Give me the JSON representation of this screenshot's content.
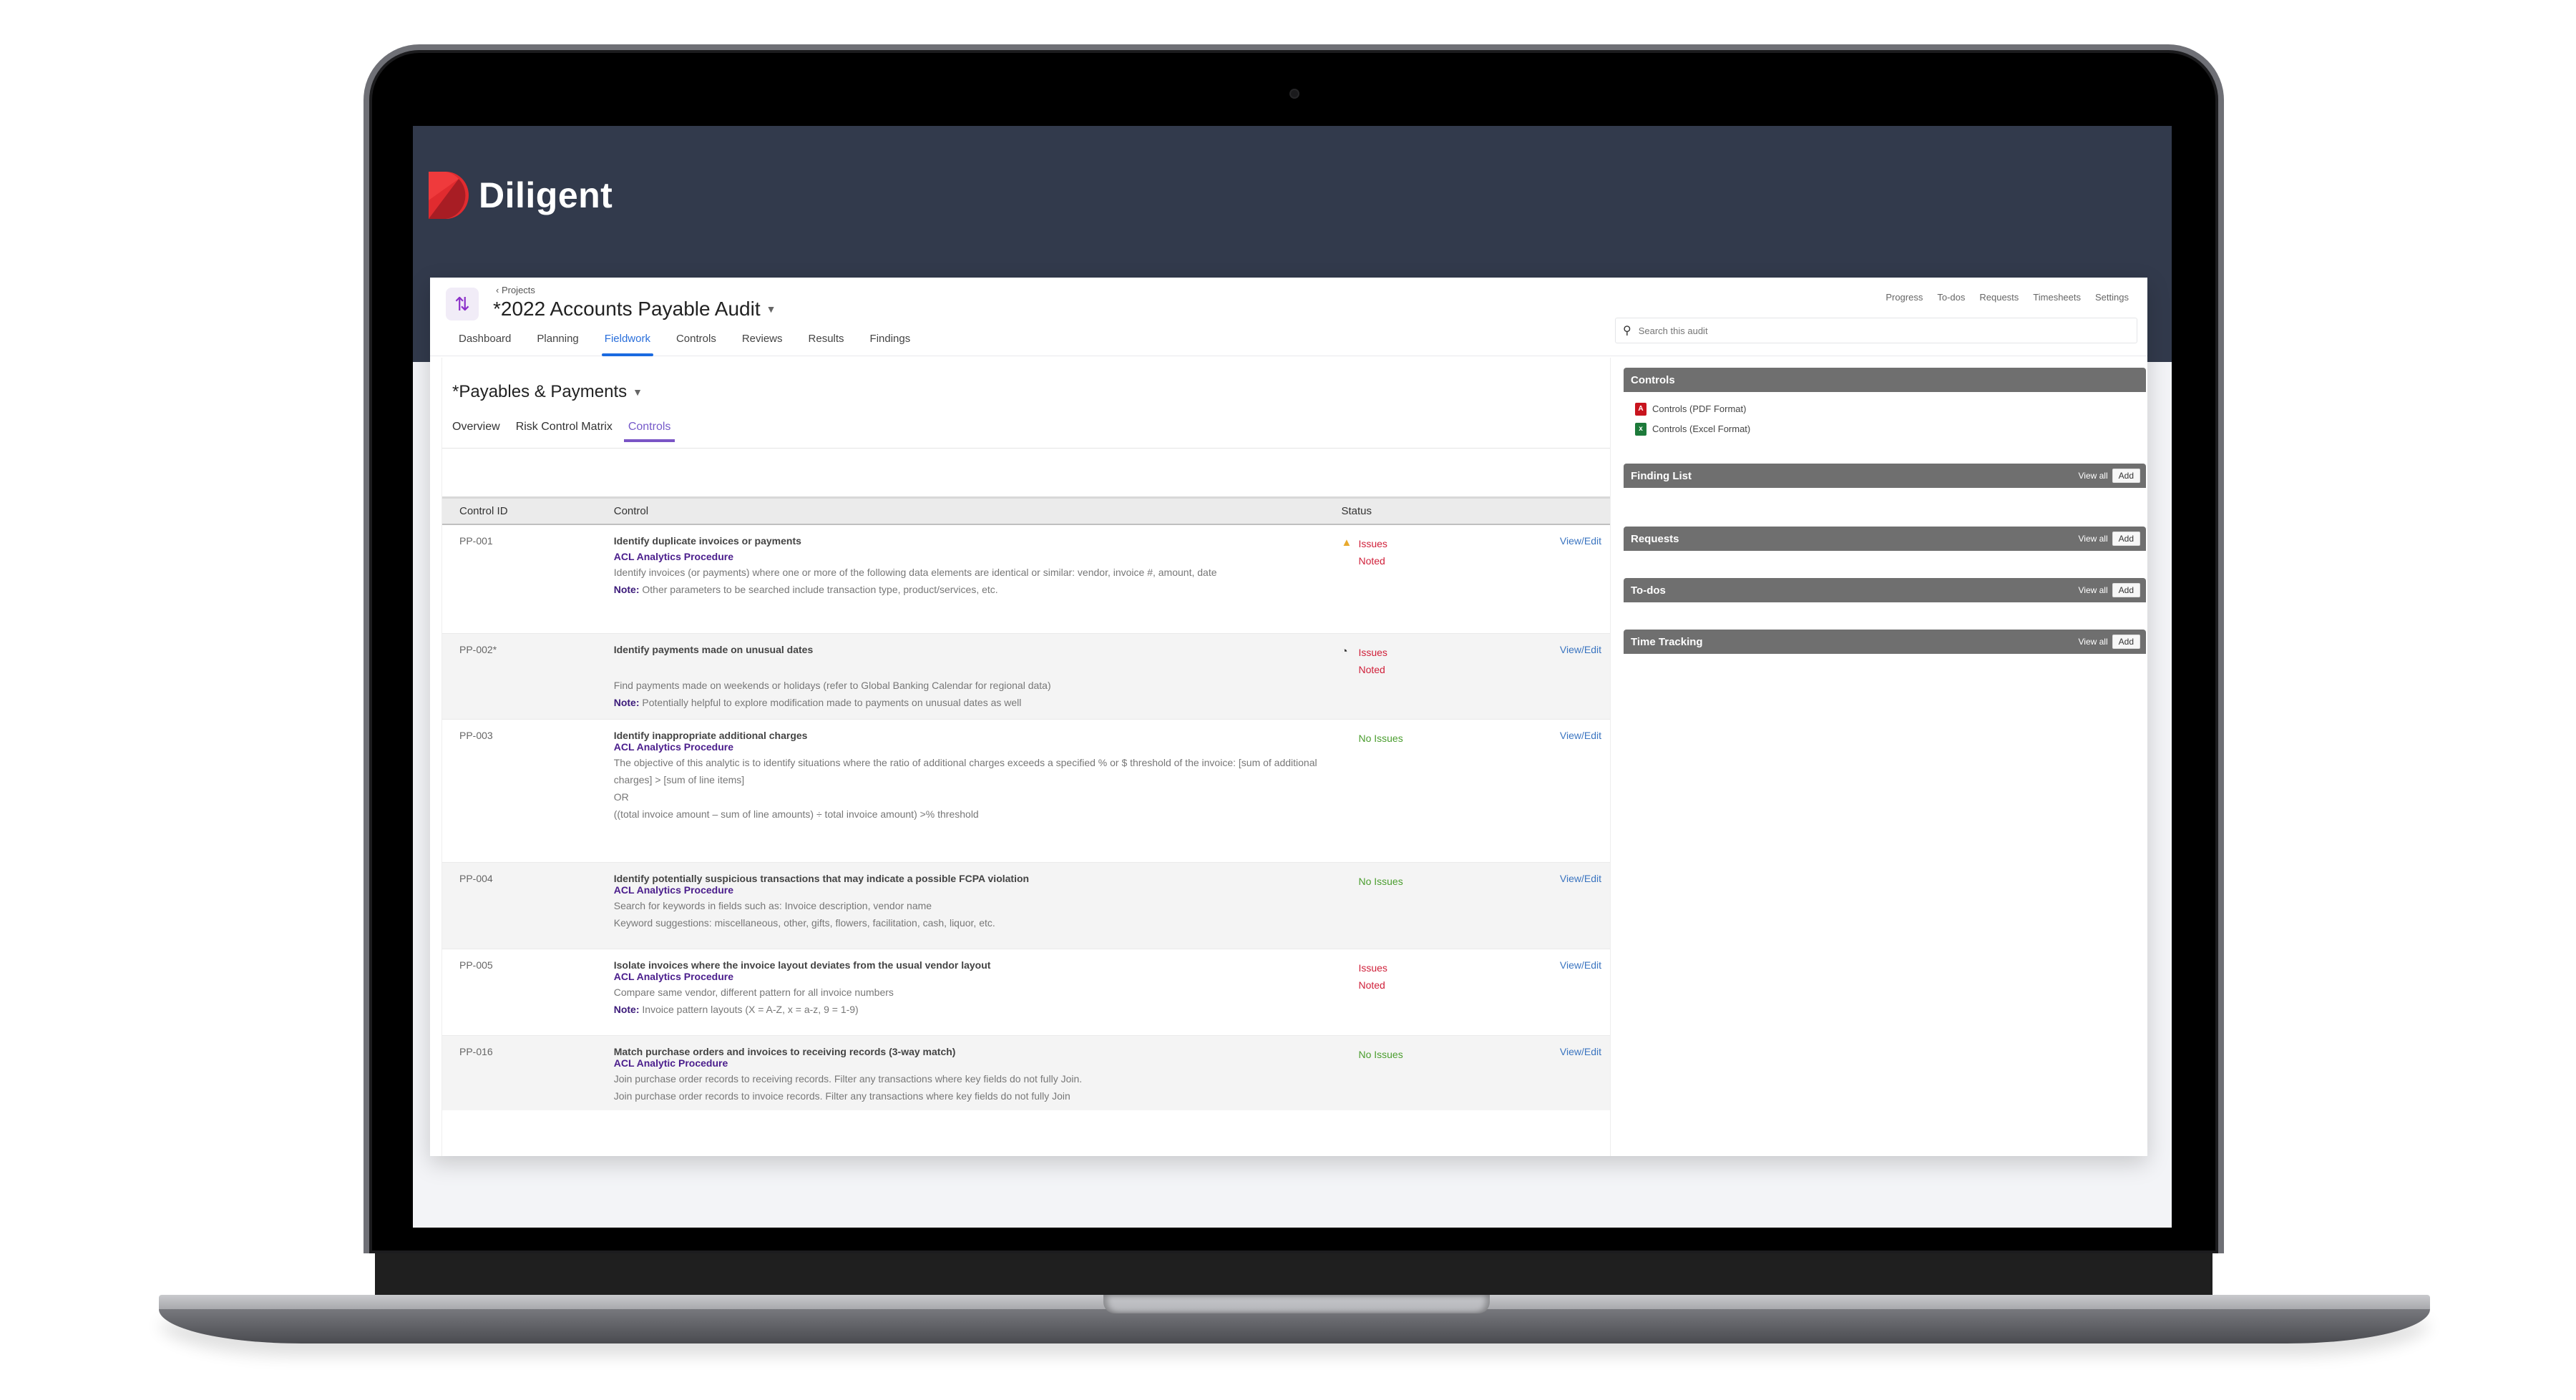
{
  "brand": {
    "name": "Diligent",
    "accent": "#e12b2f",
    "band_color": "#323a4c"
  },
  "header": {
    "breadcrumb": "Projects",
    "project_title": "*2022 Accounts Payable Audit",
    "tabs": [
      {
        "label": "Dashboard",
        "active": false
      },
      {
        "label": "Planning",
        "active": false
      },
      {
        "label": "Fieldwork",
        "active": true
      },
      {
        "label": "Controls",
        "active": false
      },
      {
        "label": "Reviews",
        "active": false
      },
      {
        "label": "Results",
        "active": false
      },
      {
        "label": "Findings",
        "active": false
      }
    ],
    "top_links": [
      "Progress",
      "To-dos",
      "Requests",
      "Timesheets",
      "Settings"
    ],
    "search": {
      "placeholder": "Search this audit",
      "value": ""
    }
  },
  "section": {
    "title": "*Payables & Payments",
    "subtabs": [
      {
        "label": "Overview",
        "active": false
      },
      {
        "label": "Risk Control Matrix",
        "active": false
      },
      {
        "label": "Controls",
        "active": true
      }
    ]
  },
  "table": {
    "columns": [
      "Control ID",
      "Control",
      "Status",
      ""
    ],
    "rows": [
      {
        "id": "PP-001",
        "title": "Identify duplicate invoices or payments",
        "procedure": "ACL Analytics Procedure",
        "description": [
          "Identify invoices (or payments) where one or more of the following data elements are identical or similar: vendor, invoice #, amount, date"
        ],
        "note": "Other parameters to be searched include transaction type, product/services, etc.",
        "status": "Issues Noted",
        "status_icon": "warning-icon",
        "action": "View/Edit"
      },
      {
        "id": "PP-002*",
        "title": "Identify payments made on unusual dates",
        "procedure": "",
        "description": [
          "Find payments made on weekends or holidays (refer to Global Banking Calendar for regional data)"
        ],
        "note": "Potentially helpful to explore modification made to payments on unusual dates as well",
        "status": "Issues Noted",
        "status_icon": "in-progress-icon",
        "action": "View/Edit"
      },
      {
        "id": "PP-003",
        "title": "Identify inappropriate additional charges",
        "procedure": "ACL Analytics Procedure",
        "description": [
          "The objective of this analytic is to identify situations where the ratio of additional charges exceeds a specified % or $ threshold of the invoice:    [sum of additional charges] > [sum of line items]",
          "OR",
          " ((total invoice amount – sum of line amounts) ÷ total invoice amount) >% threshold"
        ],
        "note": "",
        "status": "No Issues",
        "status_icon": "",
        "action": "View/Edit"
      },
      {
        "id": "PP-004",
        "title": "Identify potentially suspicious transactions that may indicate a possible FCPA violation",
        "procedure": "ACL Analytics Procedure",
        "description": [
          "Search for keywords in fields such as: Invoice description, vendor name",
          "Keyword suggestions: miscellaneous, other, gifts, flowers, facilitation, cash, liquor, etc."
        ],
        "note": "",
        "status": "No Issues",
        "status_icon": "",
        "action": "View/Edit"
      },
      {
        "id": "PP-005",
        "title": "Isolate invoices where the invoice layout deviates from the usual vendor layout",
        "procedure": "ACL Analytics Procedure",
        "description": [
          "Compare same vendor, different pattern for all invoice numbers"
        ],
        "note": "Invoice pattern layouts (X = A-Z, x = a-z, 9 = 1-9)",
        "status": "Issues Noted",
        "status_icon": "",
        "action": "View/Edit"
      },
      {
        "id": "PP-016",
        "title": "Match purchase orders and invoices to receiving records (3-way match)",
        "procedure": "ACL Analytic Procedure",
        "description": [
          "Join purchase order records to receiving records. Filter any transactions where key fields do not fully Join.",
          "Join purchase order records to invoice records. Filter any transactions where key fields do not fully Join"
        ],
        "note": "",
        "status": "No Issues",
        "status_icon": "",
        "action": "View/Edit"
      }
    ],
    "note_label": "Note:"
  },
  "sidebar": {
    "controls_widget": {
      "title": "Controls",
      "links": [
        {
          "label": "Controls (PDF Format)",
          "icon": "pdf-file-icon"
        },
        {
          "label": "Controls (Excel Format)",
          "icon": "excel-file-icon"
        }
      ]
    },
    "widgets": [
      {
        "title": "Finding List",
        "view_all": "View all",
        "add": "Add"
      },
      {
        "title": "Requests",
        "view_all": "View all",
        "add": "Add"
      },
      {
        "title": "To-dos",
        "view_all": "View all",
        "add": "Add"
      },
      {
        "title": "Time Tracking",
        "view_all": "View all",
        "add": "Add"
      }
    ]
  },
  "colors": {
    "issues": "#d0203a",
    "no_issues": "#4a9d2e",
    "link": "#3a74c0",
    "procedure": "#4a1d8c",
    "active_tab": "#1a6ae0",
    "active_subtab": "#7a55c6",
    "widget_header": "#6f6f6f"
  }
}
